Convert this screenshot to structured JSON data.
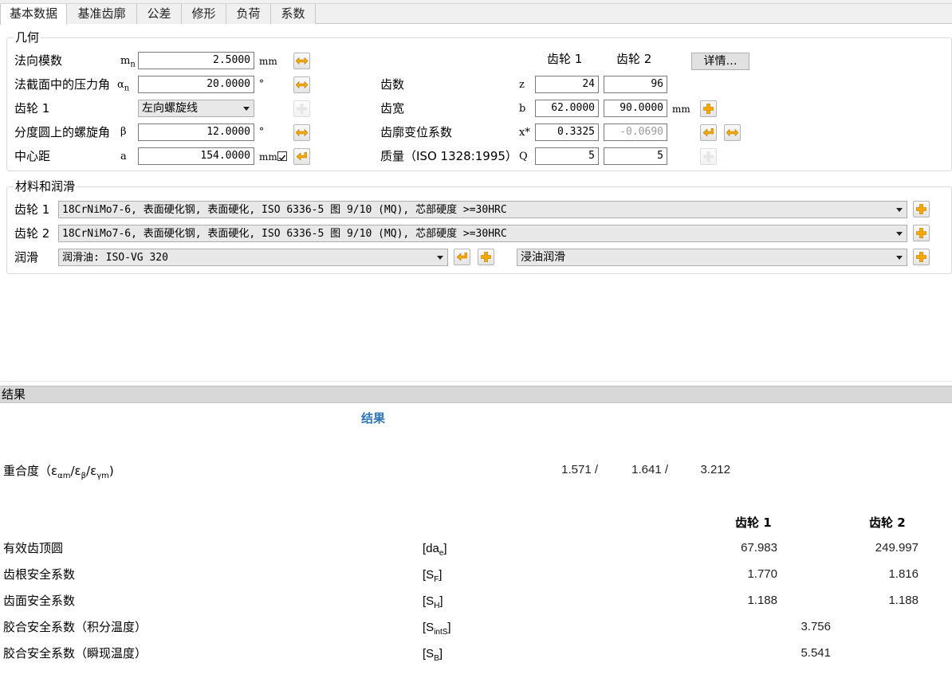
{
  "tabs": [
    "基本数据",
    "基准齿廓",
    "公差",
    "修形",
    "负荷",
    "系数"
  ],
  "geometry": {
    "title": "几何",
    "normal_module": {
      "label": "法向模数",
      "symbol": "m",
      "sub": "n",
      "value": "2.5000",
      "unit": "mm"
    },
    "pressure_angle": {
      "label": "法截面中的压力角",
      "symbol": "α",
      "sub": "n",
      "value": "20.0000",
      "unit": "°"
    },
    "gear1_hand": {
      "label": "齿轮 1",
      "value": "左向螺旋线"
    },
    "helix_angle": {
      "label": "分度圆上的螺旋角",
      "symbol": "β",
      "value": "12.0000",
      "unit": "°"
    },
    "center_distance": {
      "label": "中心距",
      "symbol": "a",
      "value": "154.0000",
      "unit": "mm"
    },
    "col_gear1": "齿轮 1",
    "col_gear2": "齿轮 2",
    "details_button": "详情…",
    "teeth": {
      "label": "齿数",
      "symbol": "z",
      "gear1": "24",
      "gear2": "96"
    },
    "face_width": {
      "label": "齿宽",
      "symbol": "b",
      "gear1": "62.0000",
      "gear2": "90.0000",
      "unit": "mm"
    },
    "profile_shift": {
      "label": "齿廓变位系数",
      "symbol": "x*",
      "gear1": "0.3325",
      "gear2": "-0.0690"
    },
    "quality": {
      "label": "质量（ISO 1328:1995）",
      "symbol": "Q",
      "gear1": "5",
      "gear2": "5"
    }
  },
  "materials": {
    "title": "材料和润滑",
    "gear1_label": "齿轮 1",
    "gear1_material": "18CrNiMo7-6, 表面硬化钢, 表面硬化, ISO 6336-5 图 9/10 (MQ), 芯部硬度 >=30HRC",
    "gear2_label": "齿轮 2",
    "gear2_material": "18CrNiMo7-6, 表面硬化钢, 表面硬化, ISO 6336-5 图 9/10 (MQ), 芯部硬度 >=30HRC",
    "lubrication_label": "润滑",
    "lubricant": "润滑油: ISO-VG 320",
    "lubrication_type": "浸油润滑"
  },
  "results": {
    "bar_title": "结果",
    "heading": "结果",
    "contact_ratio_label": "重合度（ε",
    "contact_ratio_values": [
      "1.571 /",
      "1.641 /",
      "3.212"
    ],
    "col_gear1": "齿轮 1",
    "col_gear2": "齿轮 2",
    "rows": [
      {
        "label": "有效齿顶圆",
        "sym": "[da",
        "sub": "e",
        "close": "]",
        "g1": "67.983",
        "g2": "249.997"
      },
      {
        "label": "齿根安全系数",
        "sym": "[S",
        "sub": "F",
        "close": "]",
        "g1": "1.770",
        "g2": "1.816"
      },
      {
        "label": "齿面安全系数",
        "sym": "[S",
        "sub": "H",
        "close": "]",
        "g1": "1.188",
        "g2": "1.188"
      },
      {
        "label": "胶合安全系数（积分温度）",
        "sym": "[S",
        "sub": "intS",
        "close": "]",
        "common": "3.756"
      },
      {
        "label": "胶合安全系数（瞬现温度）",
        "sym": "[S",
        "sub": "B",
        "close": "]",
        "common": "5.541"
      }
    ]
  },
  "colors": {
    "accent": "#f5a800",
    "heading_blue": "#2e75b6"
  }
}
